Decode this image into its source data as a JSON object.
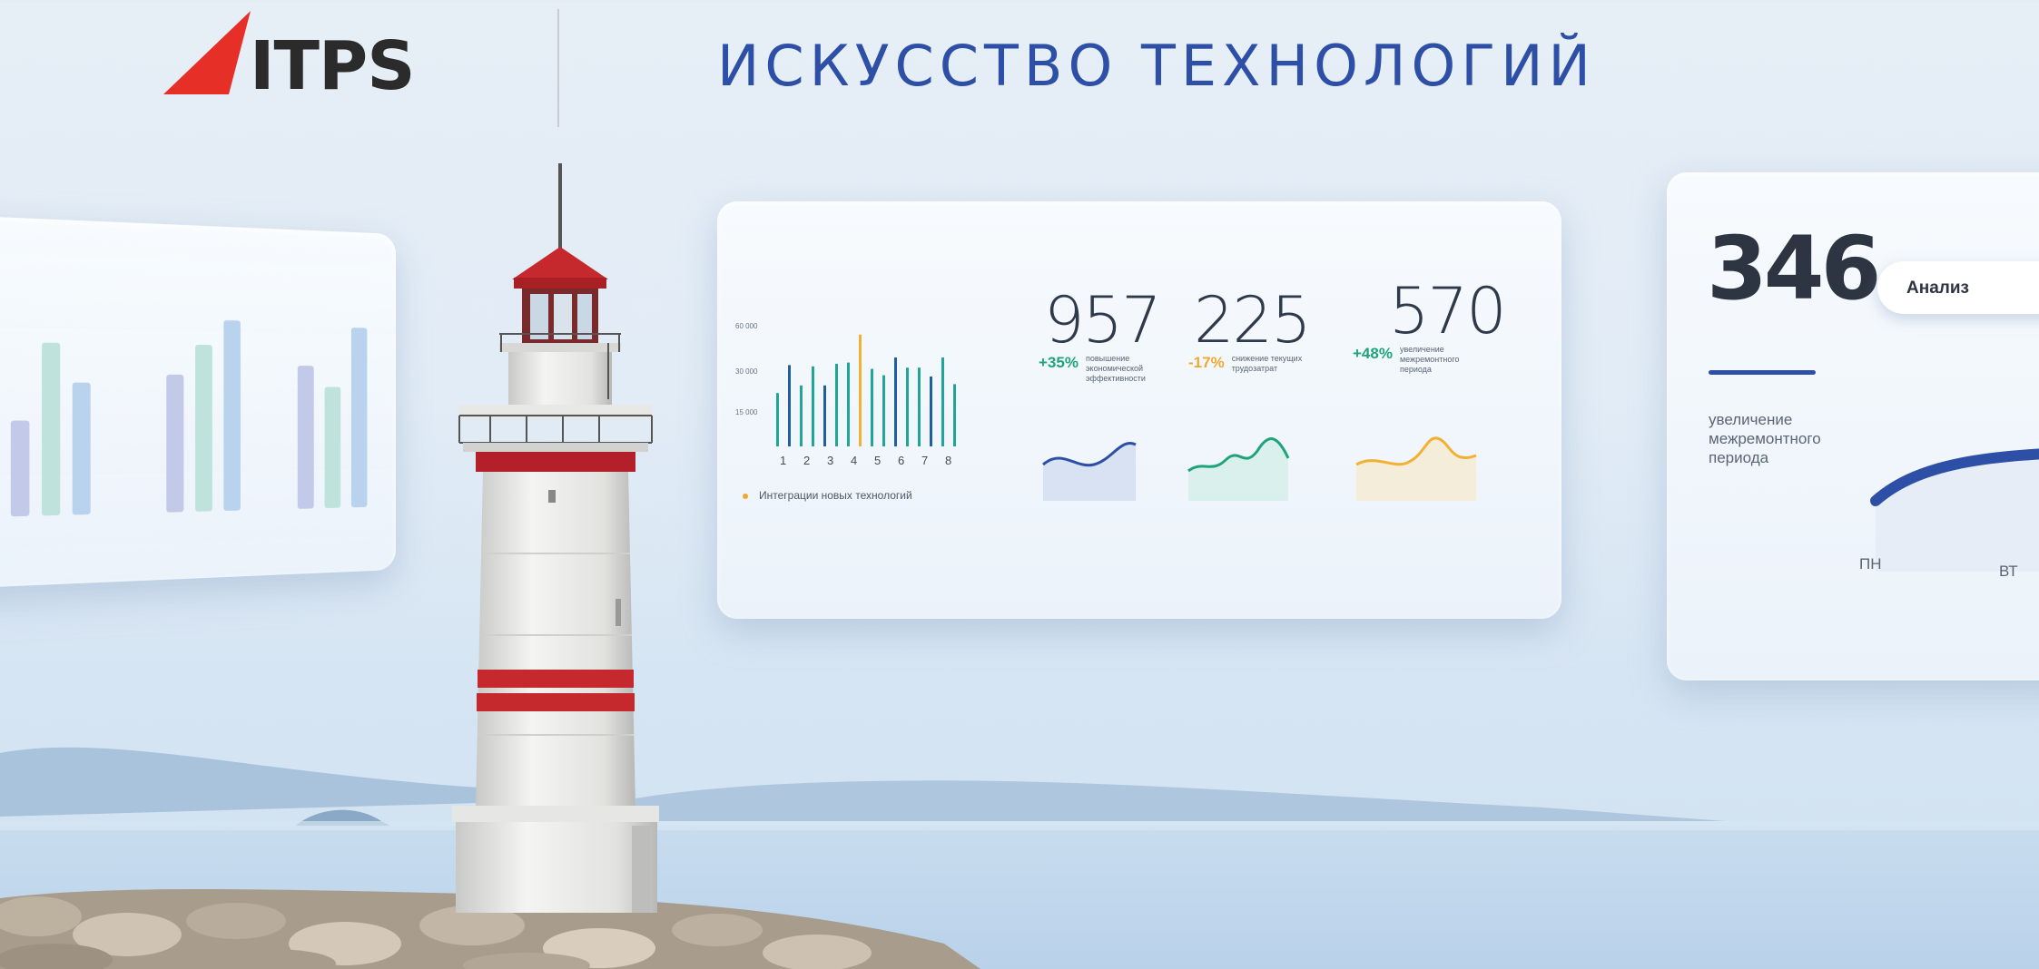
{
  "brand": {
    "logo_text": "ITPS",
    "slogan": "ИСКУССТВО ТЕХНОЛОГИЙ",
    "accent": "#e63027",
    "slogan_color": "#2e4fa6"
  },
  "left_panel": {
    "chart_data": {
      "type": "bar",
      "series": [
        {
          "name": "",
          "values": [
            0.55,
            1.0,
            0.77
          ]
        },
        {
          "name": "",
          "values": [
            0.82,
            1.0,
            1.15
          ]
        },
        {
          "name": "",
          "values": [
            0.88,
            0.75,
            1.12
          ]
        }
      ],
      "colors": [
        "#c3c9e8",
        "#bfe3dc",
        "#b9d3ef"
      ]
    }
  },
  "center_panel": {
    "chart_data": {
      "type": "bar",
      "categories": [
        "1",
        "2",
        "3",
        "4",
        "5",
        "6",
        "7",
        "8"
      ],
      "y_tick_labels": [
        "60 000",
        "30 000",
        "15 000"
      ],
      "values": [
        42,
        64,
        48,
        63,
        48,
        65,
        66,
        88,
        61,
        56,
        70,
        62,
        62,
        55,
        70,
        49
      ],
      "highlight_index": 7,
      "colors": {
        "bar": "#21a598",
        "bar_alt": "#1f5f9d",
        "highlight": "#f2b133"
      },
      "legend": "Интеграции новых технологий"
    },
    "stats": [
      {
        "value": "957",
        "pct": "+35%",
        "pct_color": "#1fa47a",
        "desc": "повышение экономической эффективности",
        "spark_color": "#2e4fa6",
        "spark_fill": "#c9d6ee"
      },
      {
        "value": "225",
        "pct": "-17%",
        "pct_color": "#f0a830",
        "desc": "снижение текущих трудозатрат",
        "spark_color": "#1fa47a",
        "spark_fill": "#c9ece2"
      },
      {
        "value": "570",
        "pct": "+48%",
        "pct_color": "#1fa47a",
        "desc": "увеличение межремонтного периода",
        "spark_color": "#f2b133",
        "spark_fill": "#f6e7c3"
      }
    ]
  },
  "right_panel": {
    "value": "346",
    "desc": "увеличение межремонтного периода",
    "button_label": "Анализ",
    "close_glyph": "✕",
    "days": [
      "ПН",
      "ВТ"
    ],
    "arc_color": "#2e4fa6"
  }
}
